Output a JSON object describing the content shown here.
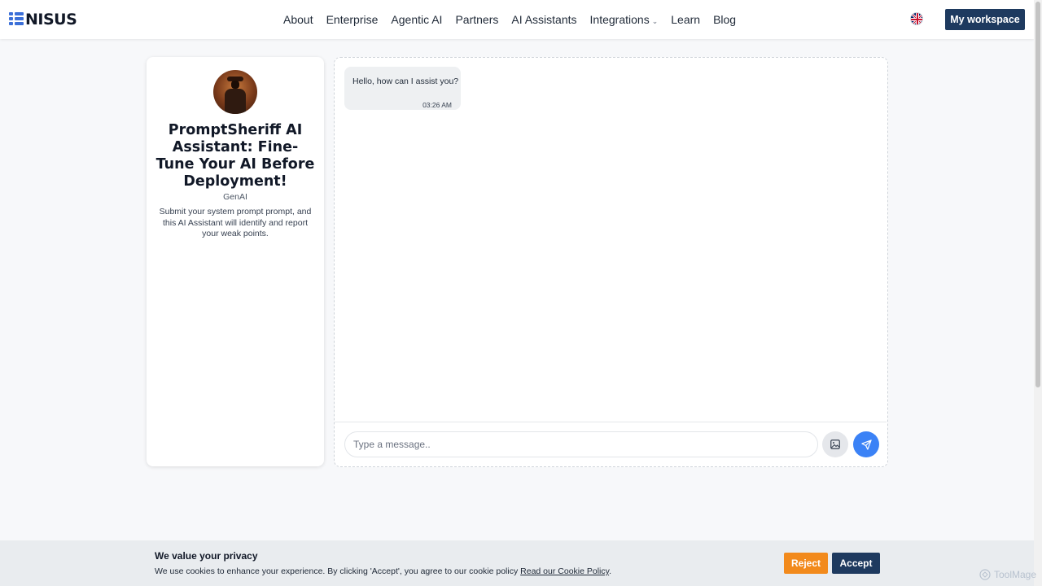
{
  "header": {
    "logo_text": "NISUS",
    "nav": [
      "About",
      "Enterprise",
      "Agentic AI",
      "Partners",
      "AI Assistants",
      "Integrations",
      "Learn",
      "Blog"
    ],
    "integrations_caret": "⌄",
    "workspace_label": "My workspace",
    "accent_color": "#1e3a5f"
  },
  "assistant": {
    "title": "PromptSheriff AI Assistant: Fine-Tune Your AI Before Deployment!",
    "category": "GenAI",
    "description": "Submit your system prompt prompt, and this AI Assistant will identify and report your weak points."
  },
  "chat": {
    "messages": [
      {
        "text": "Hello, how can I assist you?",
        "time": "03:26 AM"
      }
    ],
    "input_placeholder": "Type a message..",
    "send_color": "#3b82f6"
  },
  "cookie": {
    "title": "We value your privacy",
    "text": "We use cookies to enhance your experience. By clicking 'Accept', you agree to our cookie policy ",
    "link": "Read our Cookie Policy",
    "text_end": ".",
    "reject_label": "Reject",
    "accept_label": "Accept",
    "reject_color": "#f28a1c"
  },
  "watermark": "ToolMage"
}
